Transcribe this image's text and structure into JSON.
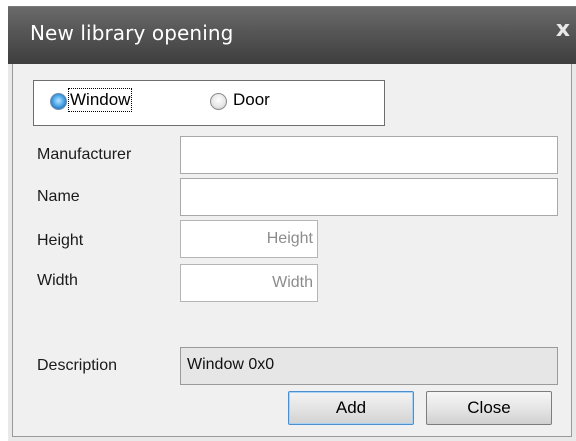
{
  "dialog": {
    "title": "New library opening",
    "close_glyph": "x"
  },
  "opening_type": {
    "selected": "Window",
    "options": [
      {
        "label": "Window",
        "checked": true
      },
      {
        "label": "Door",
        "checked": false
      }
    ]
  },
  "fields": {
    "manufacturer": {
      "label": "Manufacturer",
      "value": ""
    },
    "name": {
      "label": "Name",
      "value": ""
    },
    "height": {
      "label": "Height",
      "value": "",
      "placeholder": "Height"
    },
    "width": {
      "label": "Width",
      "value": "",
      "placeholder": "Width"
    },
    "description": {
      "label": "Description",
      "value": "Window 0x0"
    }
  },
  "buttons": {
    "add": "Add",
    "close": "Close"
  },
  "colors": {
    "titlebar": "#555555",
    "client_background": "#f0f0f0",
    "default_button_border": "#4b8fd0"
  },
  "icons": {
    "close": "close-icon",
    "radio_checked": "radio-checked-icon",
    "radio_unchecked": "radio-unchecked-icon"
  }
}
